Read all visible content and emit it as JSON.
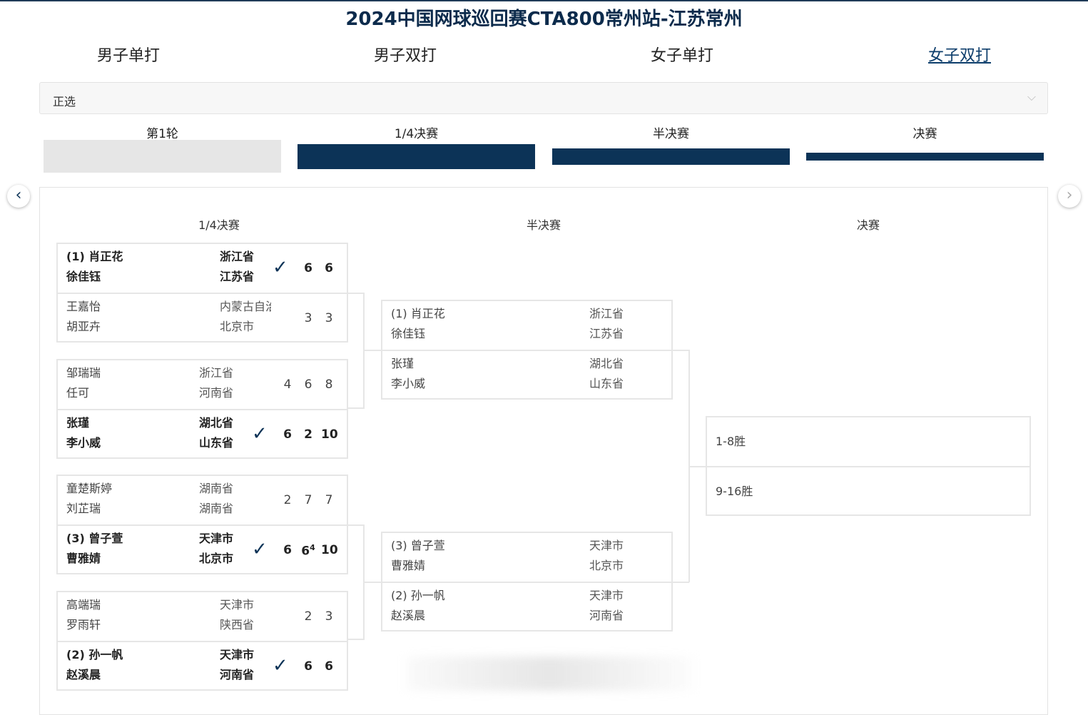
{
  "title": "2024中国网球巡回赛CTA800常州站-江苏常州",
  "tabs": [
    "男子单打",
    "男子双打",
    "女子单打",
    "女子双打"
  ],
  "active_tab": "女子双打",
  "draw_select": "正选",
  "rounds": [
    "第1轮",
    "1/4决赛",
    "半决赛",
    "决赛"
  ],
  "columns": [
    "1/4决赛",
    "半决赛",
    "决赛"
  ],
  "quarterfinals": [
    {
      "winner": "top",
      "top": {
        "players": [
          "(1) 肖正花",
          "徐佳钰"
        ],
        "provinces": [
          "浙江省",
          "江苏省"
        ],
        "scores": [
          "6",
          "6"
        ]
      },
      "bottom": {
        "players": [
          "王嘉怡",
          "胡亚卉"
        ],
        "provinces": [
          "内蒙古自治区",
          "北京市"
        ],
        "scores": [
          "3",
          "3"
        ]
      }
    },
    {
      "winner": "bottom",
      "top": {
        "players": [
          "邹瑞瑞",
          "任可"
        ],
        "provinces": [
          "浙江省",
          "河南省"
        ],
        "scores": [
          "4",
          "6",
          "8"
        ]
      },
      "bottom": {
        "players": [
          "张瑾",
          "李小威"
        ],
        "provinces": [
          "湖北省",
          "山东省"
        ],
        "scores": [
          "6",
          "2",
          "10"
        ]
      }
    },
    {
      "winner": "bottom",
      "top": {
        "players": [
          "童楚斯婷",
          "刘芷瑞"
        ],
        "provinces": [
          "湖南省",
          "湖南省"
        ],
        "scores": [
          "2",
          "7",
          "7"
        ]
      },
      "bottom": {
        "players": [
          "(3) 曾子萱",
          "曹雅婧"
        ],
        "provinces": [
          "天津市",
          "北京市"
        ],
        "scores": [
          "6",
          "6",
          "10"
        ],
        "tiebreak": "4"
      }
    },
    {
      "winner": "bottom",
      "top": {
        "players": [
          "高端瑞",
          "罗雨轩"
        ],
        "provinces": [
          "天津市",
          "陕西省"
        ],
        "scores": [
          "2",
          "3"
        ]
      },
      "bottom": {
        "players": [
          "(2) 孙一帆",
          "赵溪晨"
        ],
        "provinces": [
          "天津市",
          "河南省"
        ],
        "scores": [
          "6",
          "6"
        ]
      }
    }
  ],
  "semifinals": [
    {
      "top": {
        "players": [
          "(1) 肖正花",
          "徐佳钰"
        ],
        "provinces": [
          "浙江省",
          "江苏省"
        ]
      },
      "bottom": {
        "players": [
          "张瑾",
          "李小威"
        ],
        "provinces": [
          "湖北省",
          "山东省"
        ]
      }
    },
    {
      "top": {
        "players": [
          "(3) 曾子萱",
          "曹雅婧"
        ],
        "provinces": [
          "天津市",
          "北京市"
        ]
      },
      "bottom": {
        "players": [
          "(2) 孙一帆",
          "赵溪晨"
        ],
        "provinces": [
          "天津市",
          "河南省"
        ]
      }
    }
  ],
  "final": {
    "top": "1-8胜",
    "bottom": "9-16胜"
  },
  "icons": {
    "check": "check-icon",
    "prev": "chevron-left-icon",
    "next": "chevron-right-icon",
    "dropdown": "chevron-down-icon"
  },
  "colors": {
    "navy": "#0c3357",
    "title": "#0c2b4c",
    "border": "#e6e6e6"
  }
}
